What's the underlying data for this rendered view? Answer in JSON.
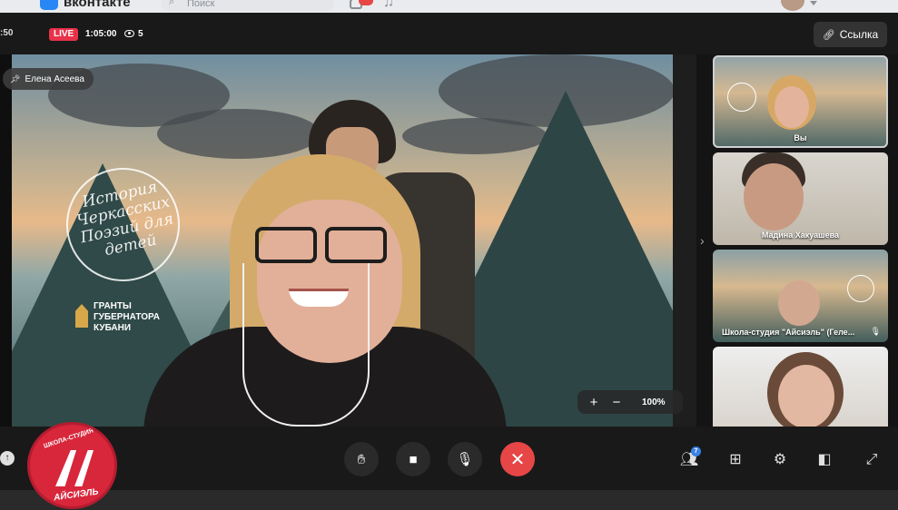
{
  "vk": {
    "logo_text": "вконтакте",
    "search_placeholder": "Поиск"
  },
  "header": {
    "elapsed_partial": ":50",
    "live_label": "LIVE",
    "live_time": "1:05:00",
    "viewers": "5",
    "link_button": "Ссылка"
  },
  "main_video": {
    "pinned_name": "Елена Асеева",
    "logo_script": "История Черкасских Поэзий для детей",
    "grants_text": [
      "ГРАНТЫ",
      "ГУБЕРНАТОРА",
      "КУБАНИ"
    ],
    "zoom_plus": "+",
    "zoom_minus": "−",
    "zoom_value": "100%"
  },
  "tiles": [
    {
      "label": "Вы",
      "active": true
    },
    {
      "label": "Мадина Хакуашева",
      "active": false
    },
    {
      "label": "Школа-студия \"Айсиэль\" (Геле...",
      "active": false,
      "mic_muted": true
    },
    {
      "label": "",
      "active": false
    }
  ],
  "controls": {
    "people_count": "7"
  },
  "stamp": {
    "top_text": "ШКОЛА-СТУДИЯ",
    "bottom_text": "АЙСИЭЛЬ"
  },
  "colors": {
    "live": "#e8324a",
    "end_call": "#e64646",
    "badge": "#3b82e6",
    "stamp": "#d8263b"
  }
}
